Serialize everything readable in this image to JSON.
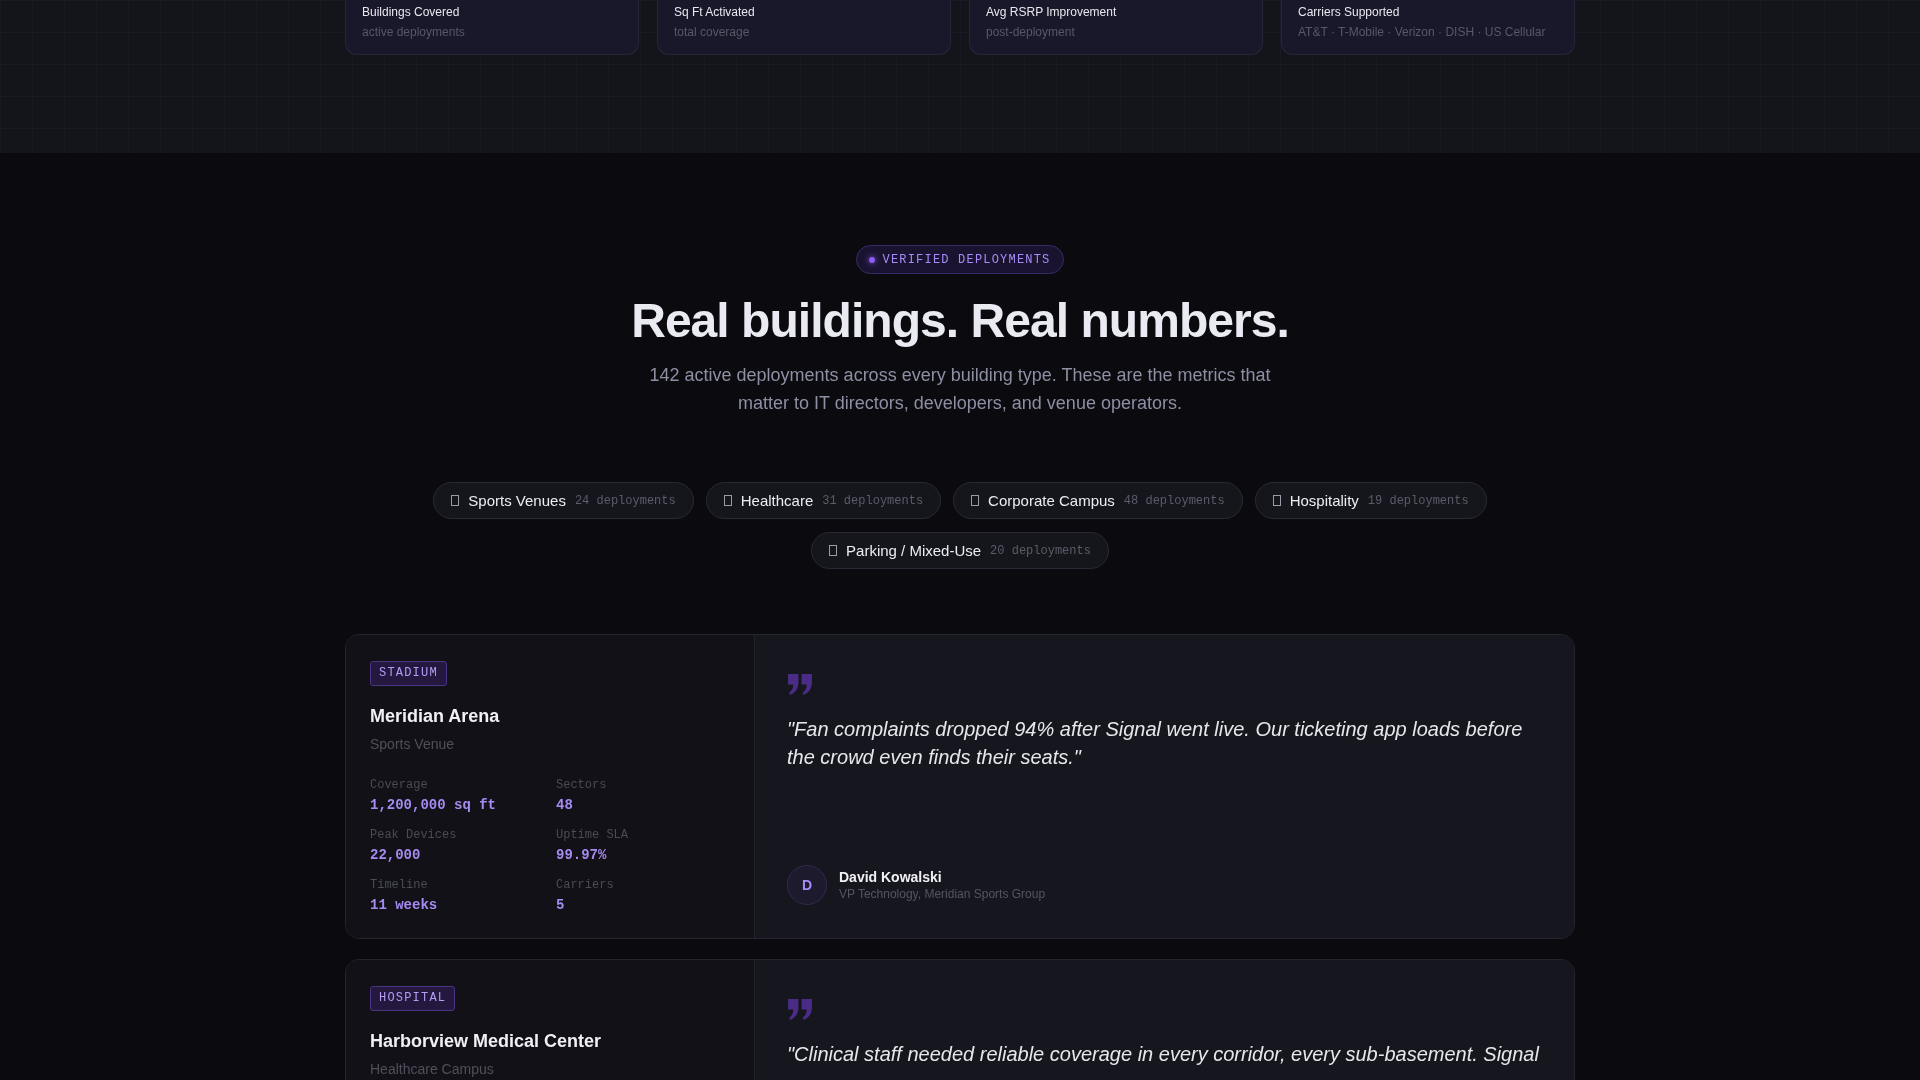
{
  "stats": [
    {
      "label": "Buildings Covered",
      "caption": "active deployments"
    },
    {
      "label": "Sq Ft Activated",
      "caption": "total coverage"
    },
    {
      "label": "Avg RSRP Improvement",
      "caption": "post-deployment"
    },
    {
      "label": "Carriers Supported",
      "caption": "AT&T · T-Mobile · Verizon · DISH · US Cellular"
    }
  ],
  "badge": {
    "label": "VERIFIED DEPLOYMENTS"
  },
  "heading": "Real buildings. Real numbers.",
  "description": "142 active deployments across every building type. These are the metrics that matter to IT directors, developers, and venue operators.",
  "filters": [
    {
      "label": "Sports Venues",
      "count": "24 deployments",
      "selected": false
    },
    {
      "label": "Healthcare",
      "count": "31 deployments",
      "selected": false
    },
    {
      "label": "Corporate Campus",
      "count": "48 deployments",
      "selected": false
    },
    {
      "label": "Hospitality",
      "count": "19 deployments",
      "selected": false
    },
    {
      "label": "Parking / Mixed-Use",
      "count": "20 deployments",
      "selected": false
    }
  ],
  "case_studies": [
    {
      "tag": "STADIUM",
      "name": "Meridian Arena",
      "type": "Sports Venue",
      "metrics": [
        {
          "label": "Coverage",
          "value": "1,200,000 sq ft"
        },
        {
          "label": "Sectors",
          "value": "48"
        },
        {
          "label": "Peak Devices",
          "value": "22,000"
        },
        {
          "label": "Uptime SLA",
          "value": "99.97%"
        },
        {
          "label": "Timeline",
          "value": "11 weeks"
        },
        {
          "label": "Carriers",
          "value": "5"
        }
      ],
      "quote": "\"Fan complaints dropped 94% after Signal went live. Our ticketing app loads before the crowd even finds their seats.\"",
      "author": {
        "initial": "D",
        "name": "David Kowalski",
        "role": "VP Technology, Meridian Sports Group"
      }
    },
    {
      "tag": "HOSPITAL",
      "name": "Harborview Medical Center",
      "type": "Healthcare Campus",
      "quote": "\"Clinical staff needed reliable coverage in every corridor, every sub-basement. Signal"
    }
  ]
}
